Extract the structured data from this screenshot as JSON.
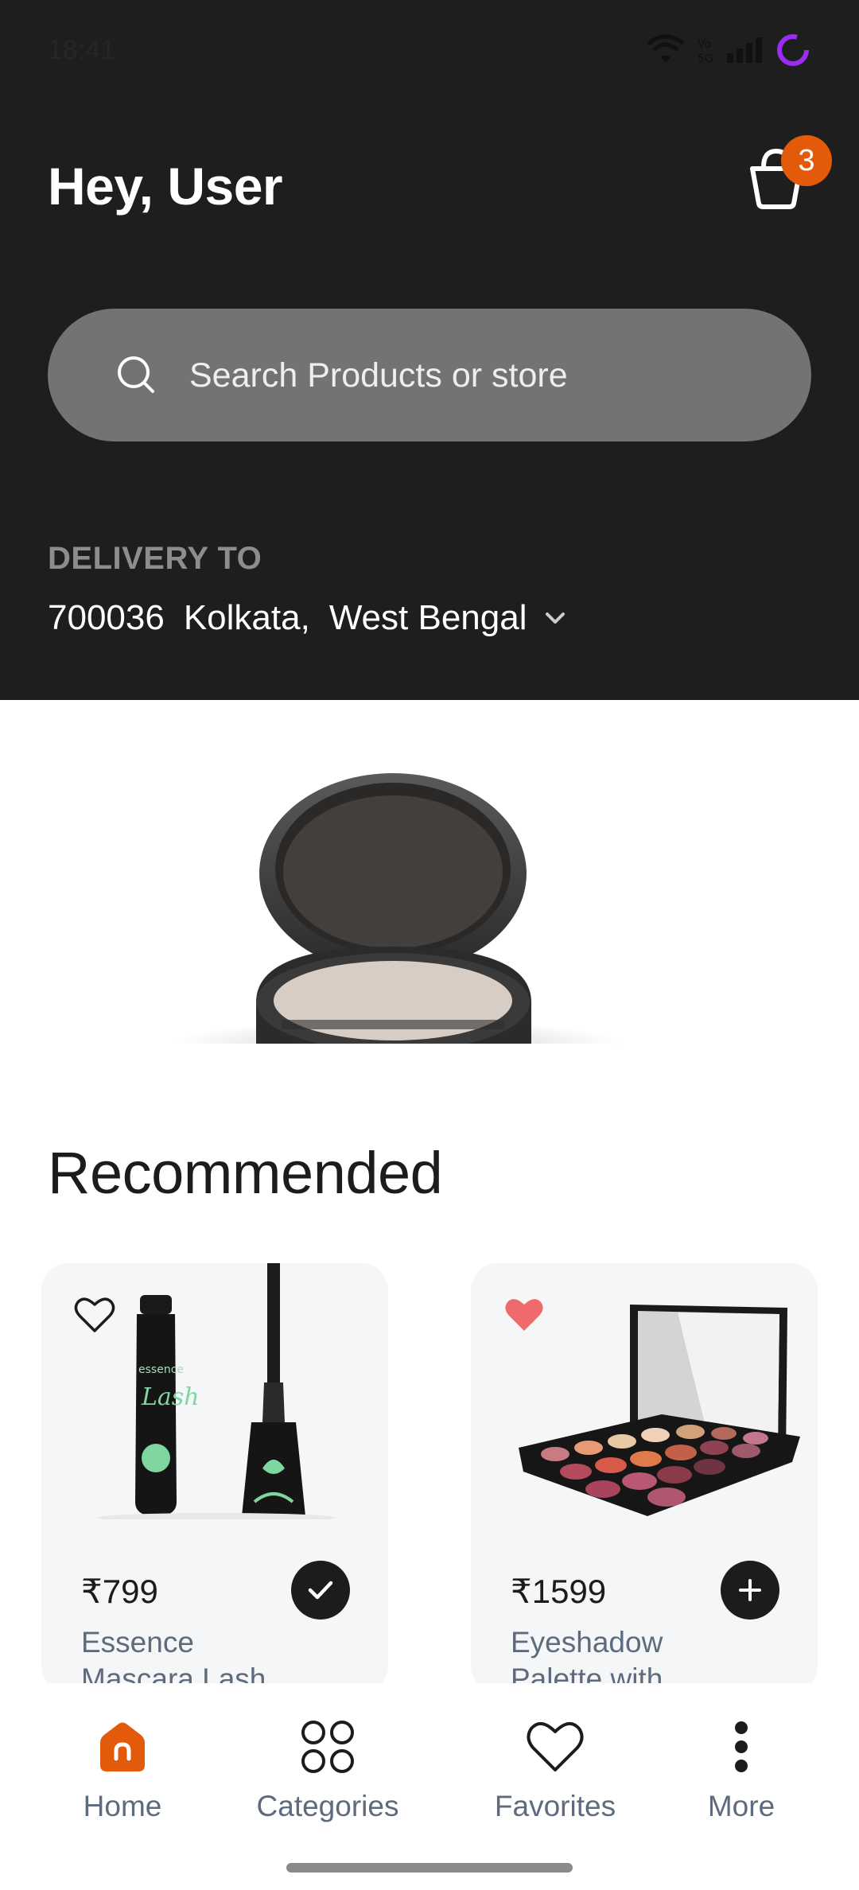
{
  "status_bar": {
    "time": "18:41",
    "icons": [
      "wifi-icon",
      "volte-icon",
      "signal-icon",
      "loading-ring-icon"
    ]
  },
  "header": {
    "greeting": "Hey, User",
    "cart_count": "3",
    "search_placeholder": "Search Products or store",
    "delivery_label": "DELIVERY TO",
    "delivery_pincode": "700036",
    "delivery_city": "Kolkata,",
    "delivery_state": "West Bengal"
  },
  "section": {
    "title": "Recommended"
  },
  "products": [
    {
      "price": "₹799",
      "name_line1": "Essence",
      "name_line2": "Mascara Lash",
      "favorited": false,
      "in_cart": true
    },
    {
      "price": "₹1599",
      "name_line1": "Eyeshadow",
      "name_line2": "Palette with",
      "favorited": true,
      "in_cart": false
    }
  ],
  "nav": {
    "items": [
      {
        "label": "Home",
        "icon": "home-icon",
        "active": true
      },
      {
        "label": "Categories",
        "icon": "categories-icon",
        "active": false
      },
      {
        "label": "Favorites",
        "icon": "heart-icon",
        "active": false
      },
      {
        "label": "More",
        "icon": "more-vertical-icon",
        "active": false
      }
    ]
  },
  "colors": {
    "header_bg": "#1f1e1f",
    "accent": "#e35a0b",
    "favorite": "#ef6b6b",
    "search_bg": "#737373",
    "card_bg": "#f5f6f8",
    "text_muted": "#5e6b7e"
  }
}
